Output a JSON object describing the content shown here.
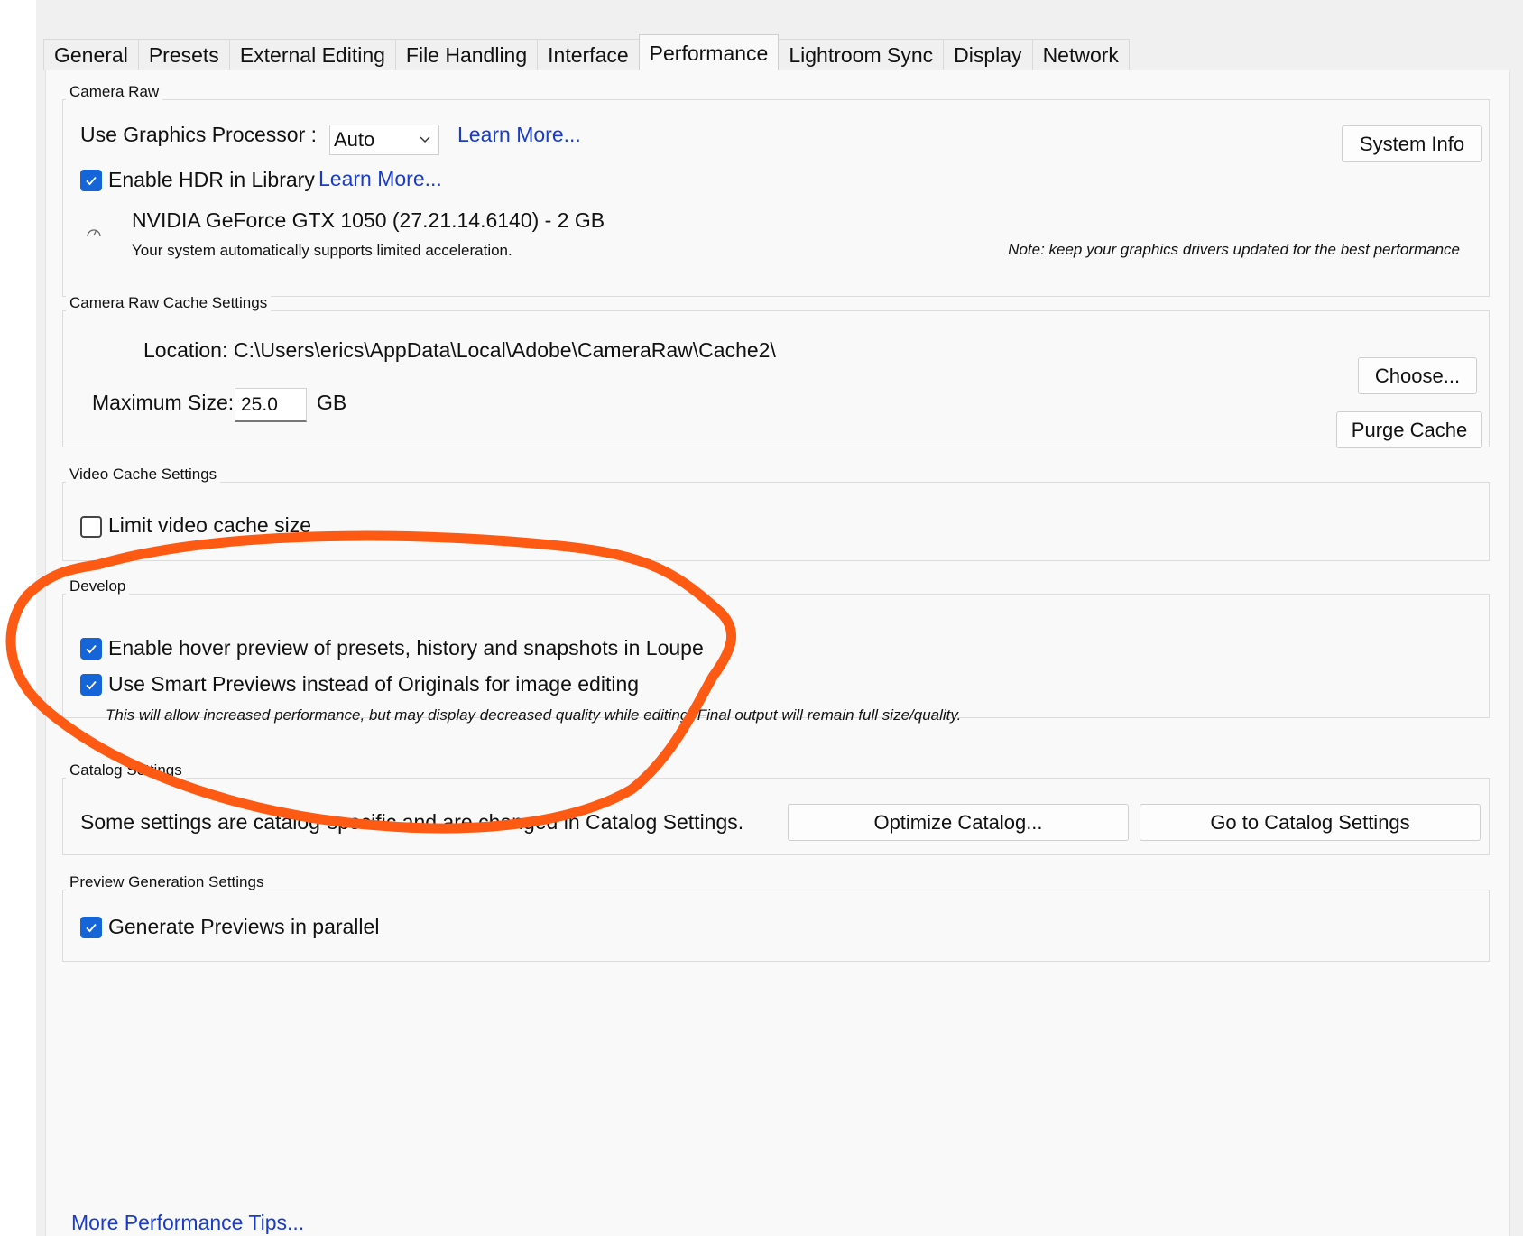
{
  "tabs": [
    {
      "label": "General"
    },
    {
      "label": "Presets"
    },
    {
      "label": "External Editing"
    },
    {
      "label": "File Handling"
    },
    {
      "label": "Interface"
    },
    {
      "label": "Performance",
      "active": true
    },
    {
      "label": "Lightroom Sync"
    },
    {
      "label": "Display"
    },
    {
      "label": "Network"
    }
  ],
  "camera_raw": {
    "legend": "Camera Raw",
    "gpu_label": "Use Graphics Processor :",
    "gpu_value": "Auto",
    "learn_more_1": "Learn More...",
    "system_info": "System Info",
    "hdr_label": "Enable HDR in Library",
    "hdr_checked": true,
    "learn_more_2": "Learn More...",
    "gpu_name": "NVIDIA GeForce GTX 1050 (27.21.14.6140) - 2 GB",
    "gpu_status": "Your system automatically supports limited acceleration.",
    "note": "Note: keep your graphics drivers updated for the best performance",
    "gauge_icon": "gauge-icon"
  },
  "cache": {
    "legend": "Camera Raw Cache Settings",
    "location_label": "Location:",
    "location_value": "C:\\Users\\erics\\AppData\\Local\\Adobe\\CameraRaw\\Cache2\\",
    "choose": "Choose...",
    "max_size_label": "Maximum Size:",
    "max_size_value": "25.0",
    "unit": "GB",
    "purge": "Purge Cache"
  },
  "video_cache": {
    "legend": "Video Cache Settings",
    "limit_label": "Limit video cache size",
    "limit_checked": false
  },
  "develop": {
    "legend": "Develop",
    "hover_label": "Enable hover preview of presets, history and snapshots in Loupe",
    "hover_checked": true,
    "smart_label": "Use Smart Previews instead of Originals for image editing",
    "smart_checked": true,
    "smart_note": "This will allow increased performance, but may display decreased quality while editing. Final output will remain full size/quality."
  },
  "catalog": {
    "legend": "Catalog Settings",
    "text": "Some settings are catalog-specific and are changed in Catalog Settings.",
    "optimize": "Optimize Catalog...",
    "goto": "Go to Catalog Settings"
  },
  "preview": {
    "legend": "Preview Generation Settings",
    "parallel_label": "Generate Previews in parallel",
    "parallel_checked": true
  },
  "footer": {
    "tips_link": "More Performance Tips..."
  },
  "colors": {
    "accent": "#1565d8",
    "link": "#1a3cc9",
    "annotation": "#ff5a14"
  }
}
